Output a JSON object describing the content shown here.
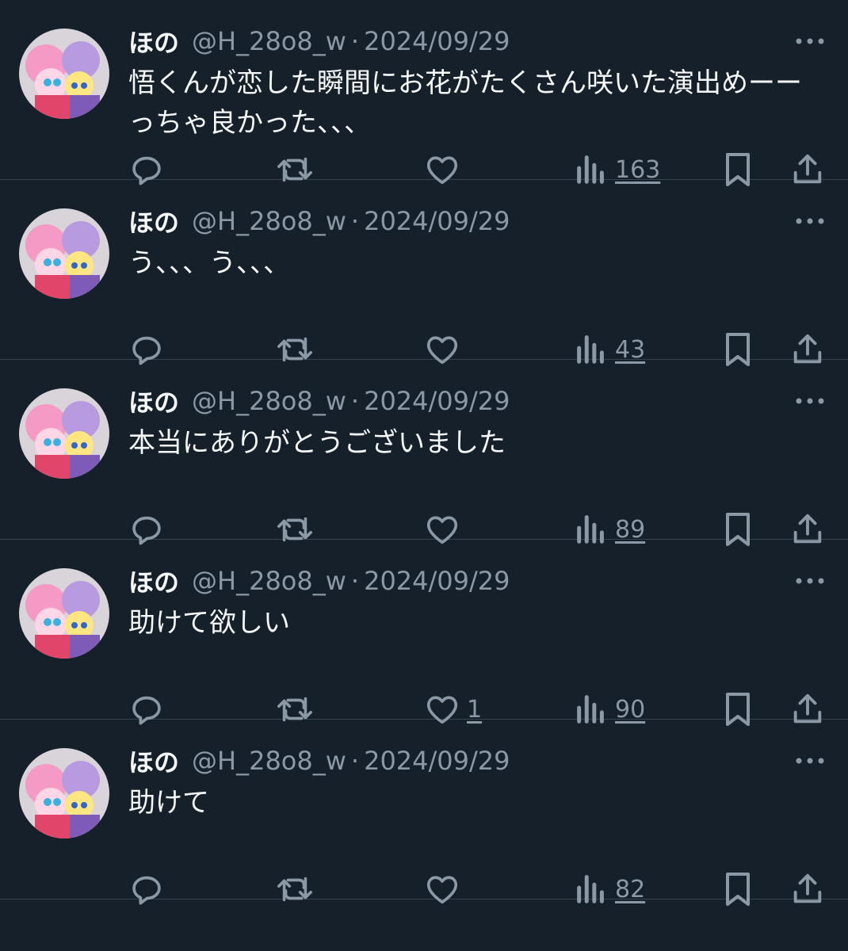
{
  "tweets": [
    {
      "name": "ほの",
      "handle": "@H_28o8_w",
      "sep": "·",
      "date": "2024/09/29",
      "text": "悟くんが恋した瞬間にお花がたくさん咲いた演出めーーっちゃ良かった、、、",
      "likes": "",
      "views": "163"
    },
    {
      "name": "ほの",
      "handle": "@H_28o8_w",
      "sep": "·",
      "date": "2024/09/29",
      "text": "う、、、う、、、",
      "likes": "",
      "views": "43"
    },
    {
      "name": "ほの",
      "handle": "@H_28o8_w",
      "sep": "·",
      "date": "2024/09/29",
      "text": "本当にありがとうございました",
      "likes": "",
      "views": "89"
    },
    {
      "name": "ほの",
      "handle": "@H_28o8_w",
      "sep": "·",
      "date": "2024/09/29",
      "text": "助けて欲しい",
      "likes": "1",
      "views": "90"
    },
    {
      "name": "ほの",
      "handle": "@H_28o8_w",
      "sep": "·",
      "date": "2024/09/29",
      "text": "助けて",
      "likes": "",
      "views": "82"
    }
  ],
  "icons": {
    "reply": "reply-icon",
    "retweet": "retweet-icon",
    "like": "heart-icon",
    "views": "views-icon",
    "bookmark": "bookmark-icon",
    "share": "share-icon",
    "more": "more-icon"
  },
  "colors": {
    "background": "#15202b",
    "text": "#f7f9f9",
    "secondary": "#8b98a5",
    "divider": "#38444d"
  }
}
